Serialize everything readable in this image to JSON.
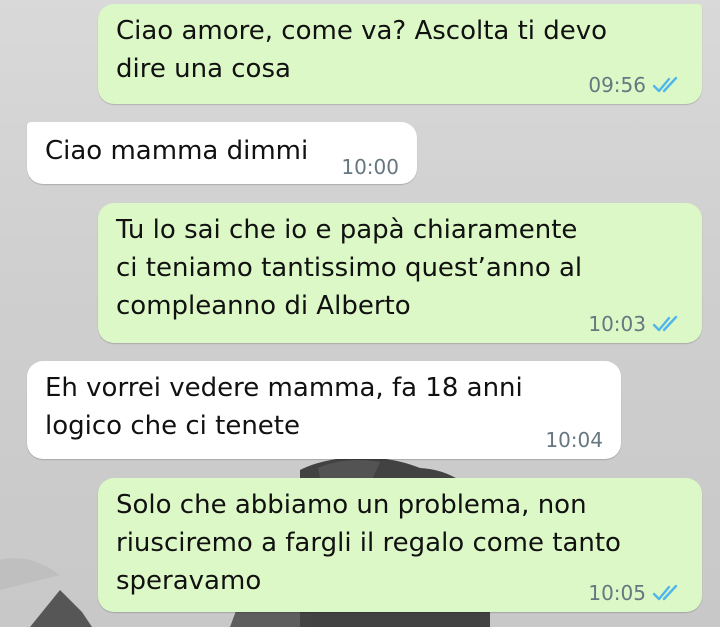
{
  "chat": {
    "messages": [
      {
        "direction": "outgoing",
        "text": "Ciao amore, come va? Ascolta ti devo\ndire una cosa",
        "time": "09:56",
        "status": "read"
      },
      {
        "direction": "incoming",
        "text": "Ciao mamma dimmi",
        "time": "10:00"
      },
      {
        "direction": "outgoing",
        "text": "Tu lo sai che io e papà chiaramente\nci teniamo tantissimo quest’anno al\ncompleanno di Alberto",
        "time": "10:03",
        "status": "read"
      },
      {
        "direction": "incoming",
        "text": "Eh vorrei vedere mamma, fa 18 anni\nlogico che ci tenete",
        "time": "10:04"
      },
      {
        "direction": "outgoing",
        "text": "Solo che abbiamo un problema, non\nriusciremo a fargli il regalo come tanto\nsperavamo",
        "time": "10:05",
        "status": "read"
      }
    ]
  },
  "icons": {
    "read_receipt": "double-check-icon"
  },
  "colors": {
    "outgoing_bubble": "#dcf8c6",
    "incoming_bubble": "#ffffff",
    "read_tick": "#4fb6ec",
    "timestamp": "#667781"
  }
}
